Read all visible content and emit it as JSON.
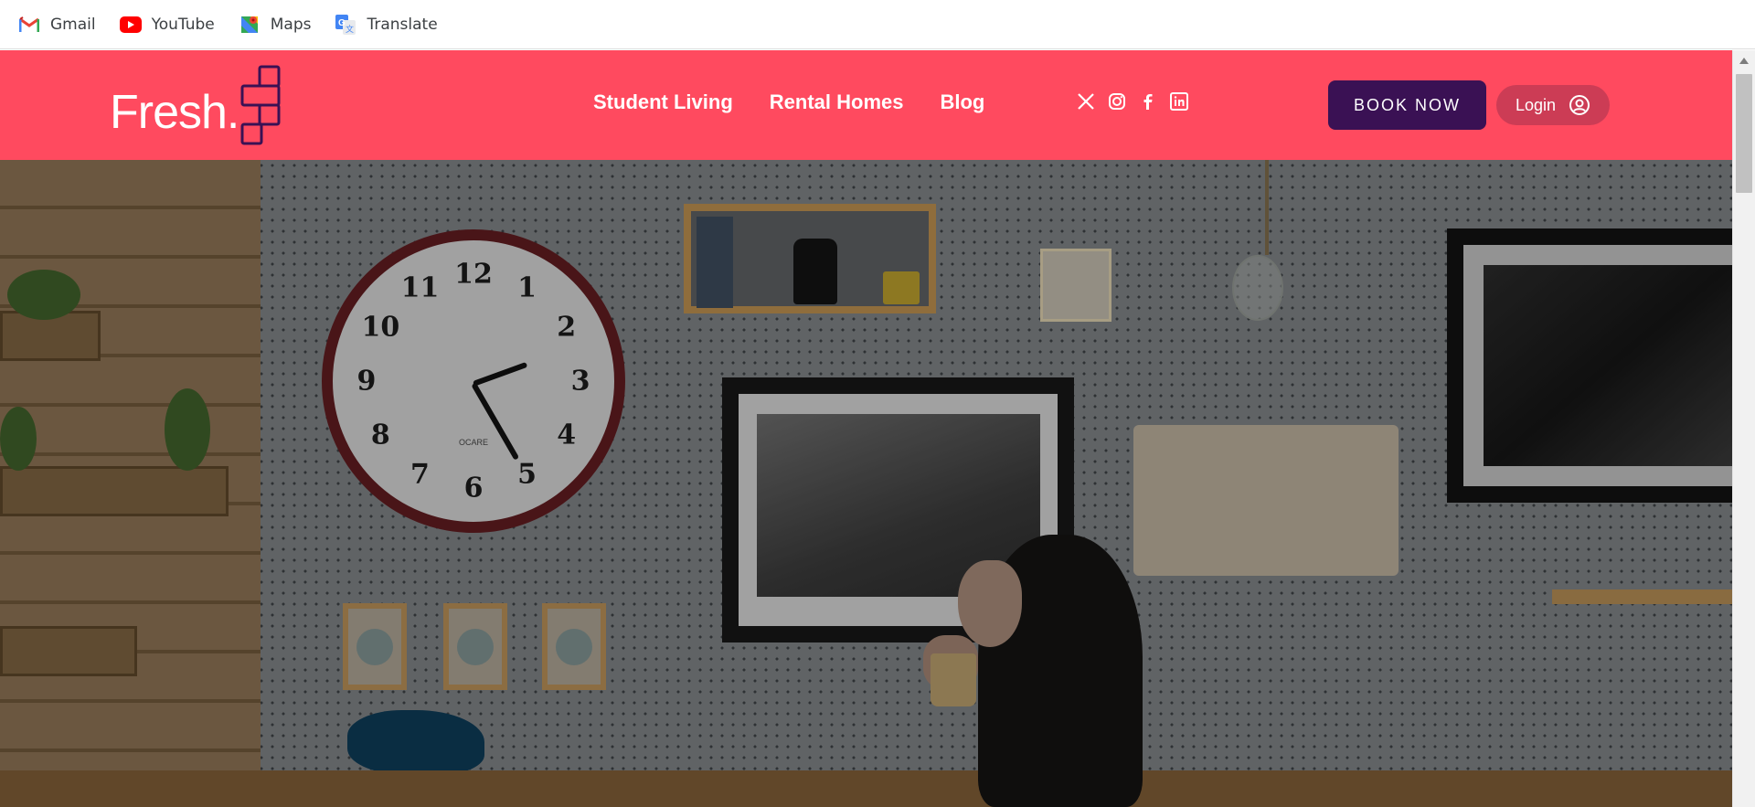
{
  "bookmarks": [
    {
      "label": "Gmail",
      "icon": "gmail-icon"
    },
    {
      "label": "YouTube",
      "icon": "youtube-icon"
    },
    {
      "label": "Maps",
      "icon": "maps-icon"
    },
    {
      "label": "Translate",
      "icon": "translate-icon"
    }
  ],
  "header": {
    "logo_text": "Fresh.",
    "nav": [
      "Student Living",
      "Rental Homes",
      "Blog"
    ],
    "social": [
      "x-icon",
      "instagram-icon",
      "facebook-icon",
      "linkedin-icon"
    ],
    "book_label": "BOOK NOW",
    "login_label": "Login"
  },
  "clock": {
    "numbers": [
      "12",
      "1",
      "2",
      "3",
      "4",
      "5",
      "6",
      "7",
      "8",
      "9",
      "10",
      "11"
    ],
    "brand": "OCARE"
  },
  "colors": {
    "header_bg": "#ff4a5f",
    "book_bg": "#3a1154",
    "login_bg": "#cc3c55",
    "logo_mark": "#3a1154"
  }
}
